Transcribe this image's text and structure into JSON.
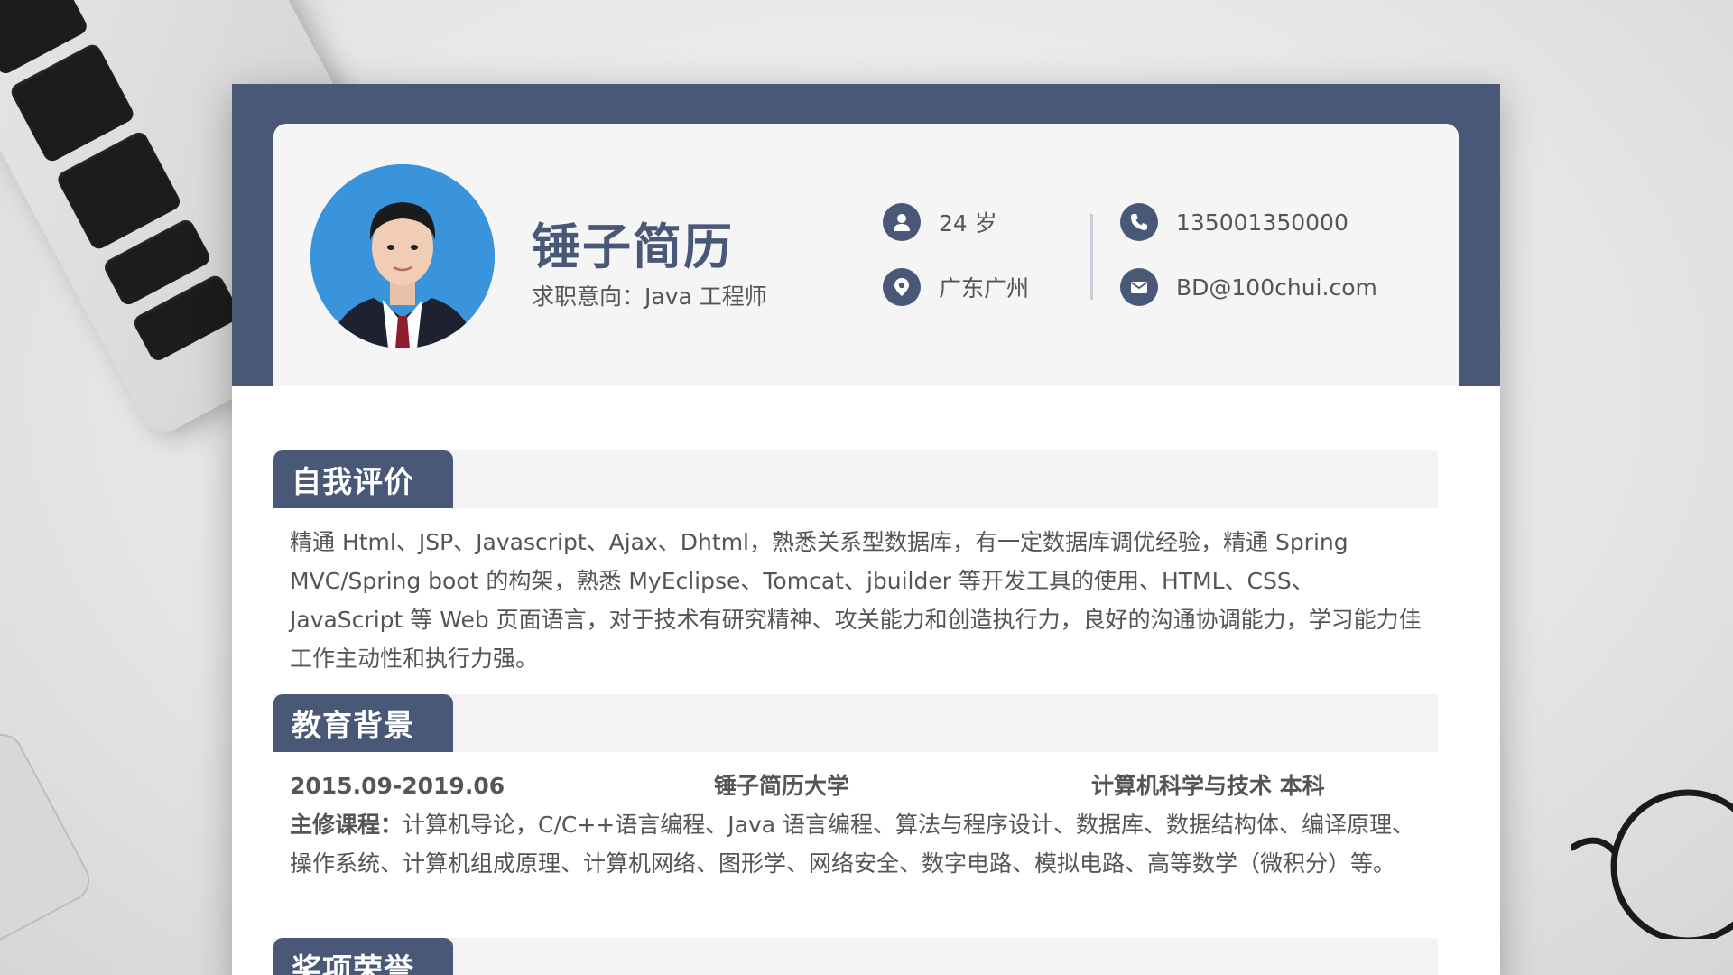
{
  "header": {
    "name": "锤子简历",
    "intent": "求职意向：Java 工程师",
    "age": "24 岁",
    "location": "广东广州",
    "phone": "135001350000",
    "email": "BD@100chui.com"
  },
  "icons": {
    "age": "user-icon",
    "location": "map-pin-icon",
    "phone": "phone-icon",
    "email": "envelope-icon"
  },
  "colors": {
    "accent": "#4a5878",
    "avatar_bg": "#3a94db"
  },
  "sections": {
    "self": {
      "title": "自我评价",
      "text": "精通 Html、JSP、Javascript、Ajax、Dhtml，熟悉关系型数据库，有一定数据库调优经验，精通 Spring MVC/Spring boot 的构架，熟悉 MyEclipse、Tomcat、jbuilder 等开发工具的使用、HTML、CSS、JavaScript 等 Web 页面语言，对于技术有研究精神、攻关能力和创造执行力，良好的沟通协调能力，学习能力佳工作主动性和执行力强。"
    },
    "education": {
      "title": "教育背景",
      "period": "2015.09-2019.06",
      "school": "锤子简历大学",
      "major": "计算机科学与技术  本科",
      "courses_label": "主修课程：",
      "courses": "计算机导论，C/C++语言编程、Java  语言编程、算法与程序设计、数据库、数据结构体、编译原理、操作系统、计算机组成原理、计算机网络、图形学、网络安全、数字电路、模拟电路、高等数学（微积分）等。"
    },
    "awards": {
      "title": "奖项荣誉"
    }
  }
}
